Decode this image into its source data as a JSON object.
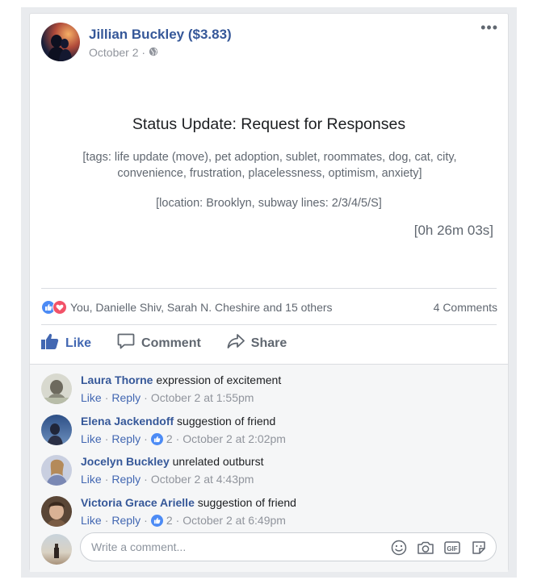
{
  "post": {
    "author": "Jillian Buckley ($3.83)",
    "date": "October 2 ·",
    "menu_icon": "more-options-icon",
    "title": "Status Update: Request for Responses",
    "tags": "[tags: life update (move), pet adoption, sublet, roommates, dog, cat, city, convenience, frustration, placelessness, optimism, anxiety]",
    "location": "[location: Brooklyn, subway lines: 2/3/4/5/S]",
    "timer": "[0h 26m 03s]"
  },
  "reactions": {
    "text": "You, Danielle Shiv, Sarah N. Cheshire and 15 others",
    "comments_count": "4 Comments",
    "colors": {
      "like": "#4c8bf5",
      "love": "#f25268"
    }
  },
  "actions": {
    "like": "Like",
    "comment": "Comment",
    "share": "Share"
  },
  "comments": [
    {
      "name": "Laura Thorne",
      "text": "expression of excitement",
      "like": "Like",
      "reply": "Reply",
      "likes": "",
      "time": "October 2 at 1:55pm"
    },
    {
      "name": "Elena Jackendoff",
      "text": "suggestion of friend",
      "like": "Like",
      "reply": "Reply",
      "likes": "2",
      "time": "October 2 at 2:02pm"
    },
    {
      "name": "Jocelyn Buckley",
      "text": "unrelated outburst",
      "like": "Like",
      "reply": "Reply",
      "likes": "",
      "time": "October 2 at 4:43pm"
    },
    {
      "name": "Victoria Grace Arielle",
      "text": "suggestion of friend",
      "like": "Like",
      "reply": "Reply",
      "likes": "2",
      "time": "October 2 at 6:49pm"
    }
  ],
  "composer": {
    "placeholder": "Write a comment...",
    "icons": [
      "emoji-icon",
      "camera-icon",
      "gif-icon",
      "sticker-icon"
    ]
  },
  "colors": {
    "link": "#365899",
    "accent": "#4267b2",
    "muted": "#90949c"
  }
}
